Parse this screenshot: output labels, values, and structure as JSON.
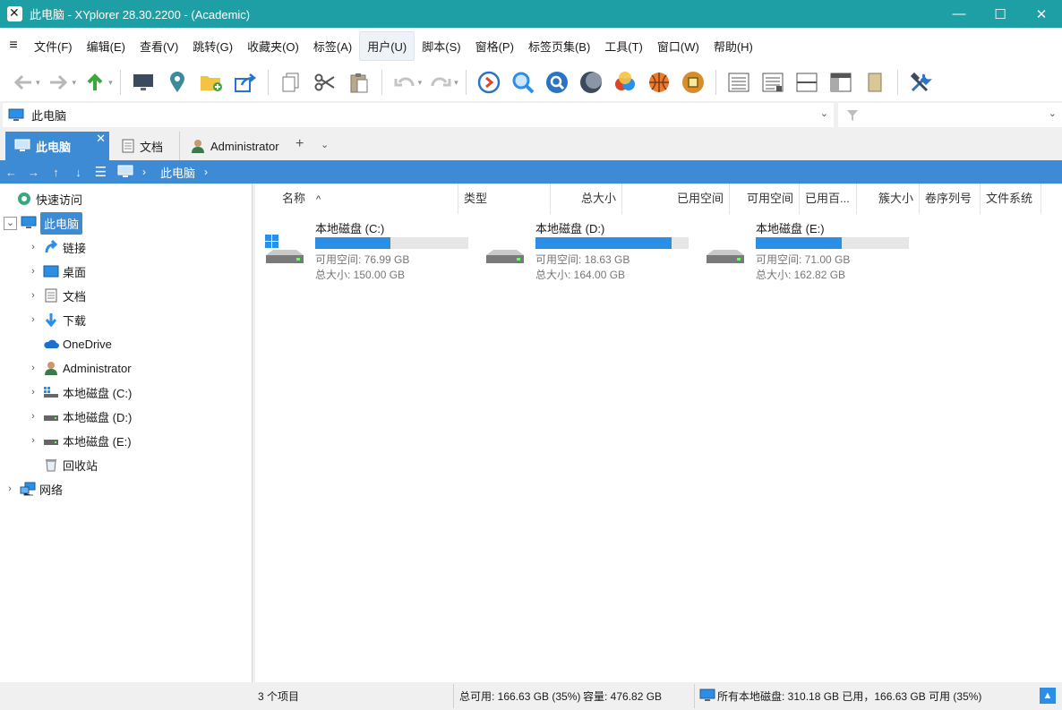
{
  "window": {
    "title": "此电脑 - XYplorer 28.30.2200 - (Academic)",
    "minimize": "—",
    "maximize": "☐",
    "close": "✕"
  },
  "menu": {
    "items": [
      {
        "label": "文件(F)"
      },
      {
        "label": "编辑(E)"
      },
      {
        "label": "查看(V)"
      },
      {
        "label": "跳转(G)"
      },
      {
        "label": "收藏夹(O)"
      },
      {
        "label": "标签(A)"
      },
      {
        "label": "用户(U)"
      },
      {
        "label": "脚本(S)"
      },
      {
        "label": "窗格(P)"
      },
      {
        "label": "标签页集(B)"
      },
      {
        "label": "工具(T)"
      },
      {
        "label": "窗口(W)"
      },
      {
        "label": "帮助(H)"
      }
    ]
  },
  "address": {
    "path": "此电脑"
  },
  "tabs": {
    "active": "此电脑",
    "close": "✕",
    "second": "文档",
    "third": "Administrator",
    "plus": "+",
    "more": "⌄"
  },
  "breadcrumb": {
    "item": "此电脑"
  },
  "tree": {
    "quick_access": "快速访问",
    "this_pc": "此电脑",
    "links": "链接",
    "desktop": "桌面",
    "documents": "文档",
    "downloads": "下载",
    "onedrive": "OneDrive",
    "admin": "Administrator",
    "drive_c": "本地磁盘 (C:)",
    "drive_d": "本地磁盘 (D:)",
    "drive_e": "本地磁盘 (E:)",
    "recycle": "回收站",
    "network": "网络"
  },
  "columns": {
    "name": "名称",
    "type": "类型",
    "total": "总大小",
    "used": "已用空间",
    "free": "可用空间",
    "used_pct": "已用百...",
    "cluster": "簇大小",
    "serial": "卷序列号",
    "fs": "文件系统"
  },
  "drives": [
    {
      "name": "本地磁盘 (C:)",
      "free": "可用空间: 76.99 GB",
      "total": "总大小: 150.00 GB",
      "used_fraction": 0.49
    },
    {
      "name": "本地磁盘 (D:)",
      "free": "可用空间: 18.63 GB",
      "total": "总大小: 164.00 GB",
      "used_fraction": 0.89
    },
    {
      "name": "本地磁盘 (E:)",
      "free": "可用空间: 71.00 GB",
      "total": "总大小: 162.82 GB",
      "used_fraction": 0.56
    }
  ],
  "status": {
    "count": "3 个项目",
    "free": "总可用: 166.63 GB (35%)",
    "capacity": "容量: 476.82 GB",
    "summary": "所有本地磁盘: 310.18 GB 已用，166.63 GB 可用 (35%)"
  },
  "colors": {
    "titlebar": "#1e9fa6",
    "accent": "#3c8bd4",
    "bar_fill": "#2b8fe8"
  }
}
